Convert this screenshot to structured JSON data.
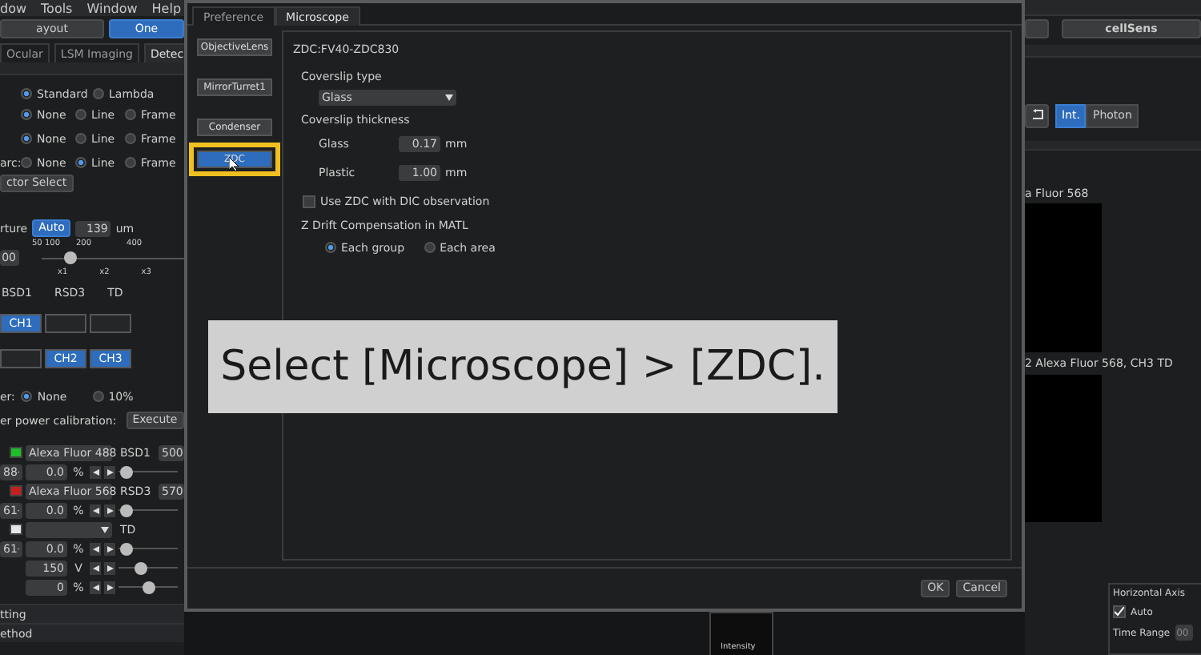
{
  "menu_bar": [
    "dow",
    "Tools",
    "Window",
    "Help"
  ],
  "left_panel": {
    "layout_button": "ayout",
    "one_button": "One",
    "tabs": [
      {
        "label": "Ocular",
        "selected": false
      },
      {
        "label": "LSM Imaging",
        "selected": false
      },
      {
        "label": "Detec",
        "selected": true
      }
    ],
    "radio_rows": [
      {
        "options": [
          {
            "label": "Standard",
            "selected": true
          },
          {
            "label": "Lambda",
            "selected": false
          }
        ]
      },
      {
        "options": [
          {
            "label": "None",
            "selected": true
          },
          {
            "label": "Line",
            "selected": false
          },
          {
            "label": "Frame",
            "selected": false
          }
        ]
      },
      {
        "options": [
          {
            "label": "None",
            "selected": true
          },
          {
            "label": "Line",
            "selected": false
          },
          {
            "label": "Frame",
            "selected": false
          }
        ]
      },
      {
        "label": "arc:",
        "options": [
          {
            "label": "None",
            "selected": false
          },
          {
            "label": "Line",
            "selected": true
          },
          {
            "label": "Frame",
            "selected": false
          }
        ]
      }
    ],
    "detector_select_button": "ctor Select",
    "aperture": {
      "label": "rture",
      "auto_button": "Auto",
      "value": "139",
      "unit": "um"
    },
    "zoom": {
      "scale_labels": [
        "50 100",
        "200",
        "400"
      ],
      "value": "00",
      "level": 0.17,
      "marks": [
        "x1",
        "x2",
        "x3"
      ]
    },
    "detectors": [
      "BSD1",
      "RSD3",
      "TD"
    ],
    "channel_grid": [
      [
        {
          "label": "CH1",
          "selected": true
        },
        {
          "selected": false
        },
        {
          "selected": false
        }
      ],
      [
        {
          "selected": false
        },
        {
          "label": "CH2",
          "selected": true
        },
        {
          "label": "CH3",
          "selected": true
        }
      ]
    ],
    "filter": {
      "label": "er:",
      "options": [
        {
          "label": "None",
          "selected": true
        },
        {
          "label": "10%",
          "selected": false
        }
      ]
    },
    "calibration": {
      "label": "er power calibration:",
      "button": "Execute"
    },
    "channels": [
      {
        "color": "#1fbf2a",
        "dye": "Alexa Fluor 488",
        "detector": "BSD1",
        "wavelength": "500",
        "laser": "88",
        "power": "0.0",
        "unit": "%",
        "level": 0.05
      },
      {
        "color": "#c81e1e",
        "dye": "Alexa Fluor 568",
        "detector": "RSD3",
        "wavelength": "570",
        "laser": "61",
        "power": "0.0",
        "unit": "%",
        "level": 0.05
      },
      {
        "color": "#e6e6e6",
        "detector": "TD",
        "laser": "61",
        "power": "0.0",
        "unit": "%",
        "level": 0.05
      }
    ],
    "extra_rows": [
      {
        "value": "150",
        "unit": "V",
        "level": 0.35
      },
      {
        "value": "0",
        "unit": "%",
        "level": 0.5
      }
    ],
    "sections": [
      "tting",
      "ethod"
    ]
  },
  "dialog": {
    "tabs": [
      {
        "label": "Preference",
        "selected": false
      },
      {
        "label": "Microscope",
        "selected": true
      }
    ],
    "categories": [
      {
        "label": "ObjectiveLens",
        "selected": false
      },
      {
        "label": "MirrorTurret1",
        "selected": false
      },
      {
        "label": "Condenser",
        "selected": false
      },
      {
        "label": "ZDC",
        "selected": true
      }
    ],
    "device": "ZDC:FV40-ZDC830",
    "coverslip_type": {
      "label": "Coverslip type",
      "value": "Glass"
    },
    "coverslip_thickness": {
      "label": "Coverslip thickness",
      "rows": [
        {
          "label": "Glass",
          "value": "0.17",
          "unit": "mm"
        },
        {
          "label": "Plastic",
          "value": "1.00",
          "unit": "mm"
        }
      ]
    },
    "dic_checkbox": {
      "label": "Use ZDC with DIC observation",
      "checked": false
    },
    "drift": {
      "label": "Z Drift Compensation in MATL",
      "options": [
        {
          "label": "Each group",
          "selected": true
        },
        {
          "label": "Each area",
          "selected": false
        }
      ]
    },
    "buttons": [
      "OK",
      "Cancel"
    ]
  },
  "caption": "Select [Microscope] > [ZDC].",
  "right_panel": {
    "cellsens_button": "cellSens",
    "mode_buttons": [
      {
        "label": "Int.",
        "selected": true
      },
      {
        "label": "Photon",
        "selected": false
      }
    ],
    "image_labels": [
      "a Fluor 568",
      "2 Alexa Fluor 568, CH3 TD"
    ],
    "horizontal_axis": {
      "title": "Horizontal Axis",
      "auto": {
        "label": "Auto",
        "checked": true
      },
      "time_range_label": "Time Range",
      "time_range_value": "00"
    }
  },
  "graph": {
    "axis_label": "Intensity"
  }
}
